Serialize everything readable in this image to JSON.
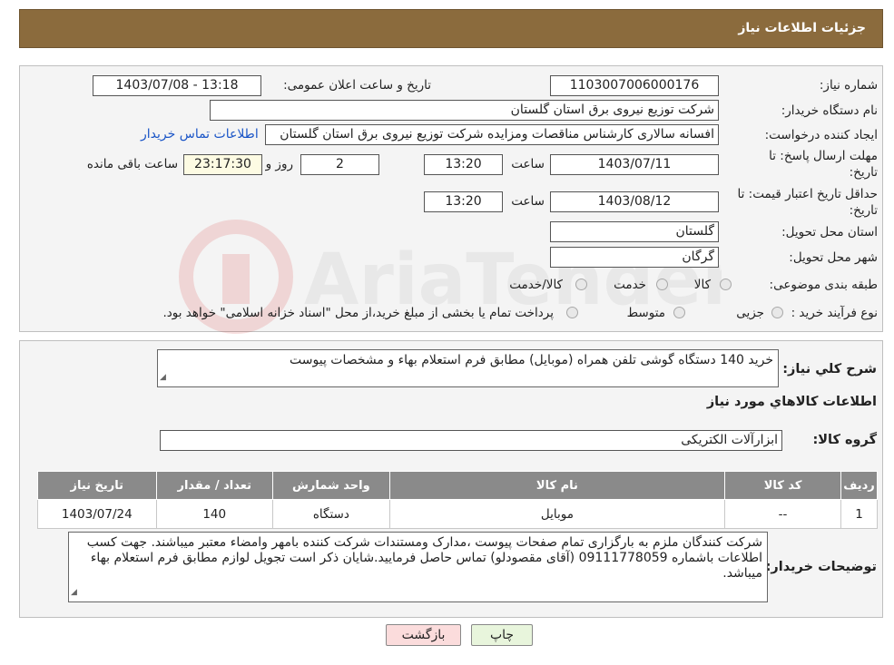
{
  "header": {
    "title": "جزئیات اطلاعات نیاز"
  },
  "form": {
    "need_number_label": "شماره نیاز:",
    "need_number": "1103007006000176",
    "announce_label": "تاریخ و ساعت اعلان عمومی:",
    "announce_value": "1403/07/08 - 13:18",
    "buyer_org_label": "نام دستگاه خریدار:",
    "buyer_org": "شرکت توزیع نیروی برق استان گلستان",
    "creator_label": "ایجاد کننده درخواست:",
    "creator": "افسانه سالاری کارشناس مناقصات ومزایده شرکت توزیع نیروی برق استان گلستان",
    "contact_link": "اطلاعات تماس خریدار",
    "deadline_label_1": "مهلت ارسال پاسخ: تا",
    "deadline_label_2": "تاریخ:",
    "deadline_date": "1403/07/11",
    "time_label": "ساعت",
    "deadline_time": "13:20",
    "days_value": "2",
    "days_label": "روز و",
    "remaining_time": "23:17:30",
    "remaining_label": "ساعت باقی مانده",
    "validity_label_1": "حداقل تاریخ اعتبار قیمت: تا",
    "validity_label_2": "تاریخ:",
    "validity_date": "1403/08/12",
    "validity_time_label": "ساعت",
    "validity_time": "13:20",
    "province_label": "استان محل تحویل:",
    "province": "گلستان",
    "city_label": "شهر محل تحویل:",
    "city": "گرگان",
    "category_label": "طبقه بندی موضوعی:",
    "category_options": [
      "کالا",
      "خدمت",
      "کالا/خدمت"
    ],
    "process_label": "نوع فرآیند خرید :",
    "process_options": [
      "جزیی",
      "متوسط"
    ],
    "payment_note": "پرداخت تمام یا بخشی از مبلغ خرید،از محل \"اسناد خزانه اسلامی\" خواهد بود."
  },
  "summary": {
    "description_label": "شرح کلي نياز:",
    "description": "خرید 140 دستگاه گوشی تلفن همراه (موبایل) مطابق فرم استعلام بهاء و مشخصات  پیوست",
    "goods_info_title": "اطلاعات کالاهاي مورد نياز",
    "goods_group_label": "گروه کالا:",
    "goods_group": "ابزارآلات الکتریکی"
  },
  "table": {
    "headers": [
      "ردیف",
      "کد کالا",
      "نام کالا",
      "واحد شمارش",
      "تعداد / مقدار",
      "تاریخ نیاز"
    ],
    "rows": [
      {
        "row": "1",
        "code": "--",
        "name": "موبایل",
        "unit": "دستگاه",
        "qty": "140",
        "date": "1403/07/24"
      }
    ]
  },
  "notes": {
    "label": "توضیحات خریدار:",
    "text": "شرکت کنندگان ملزم به بارگزاری تمام صفحات پیوست ،مدارک ومستندات شرکت کننده بامهر وامضاء معتبر میباشند. جهت کسب اطلاعات باشماره 09111778059 (آقای مقصودلو) تماس حاصل فرمایید.شایان ذکر است تجویل لوازم مطابق فرم استعلام بهاء میباشد."
  },
  "buttons": {
    "print": "چاپ",
    "back": "بازگشت"
  },
  "watermark": {
    "text": "AriaTender.neT"
  },
  "colors": {
    "header_bg": "#8b6b3d",
    "table_header": "#8a8a8a",
    "link": "#1a55c7",
    "back_btn": "#fbdcdc",
    "print_btn": "#e8f5dc"
  }
}
